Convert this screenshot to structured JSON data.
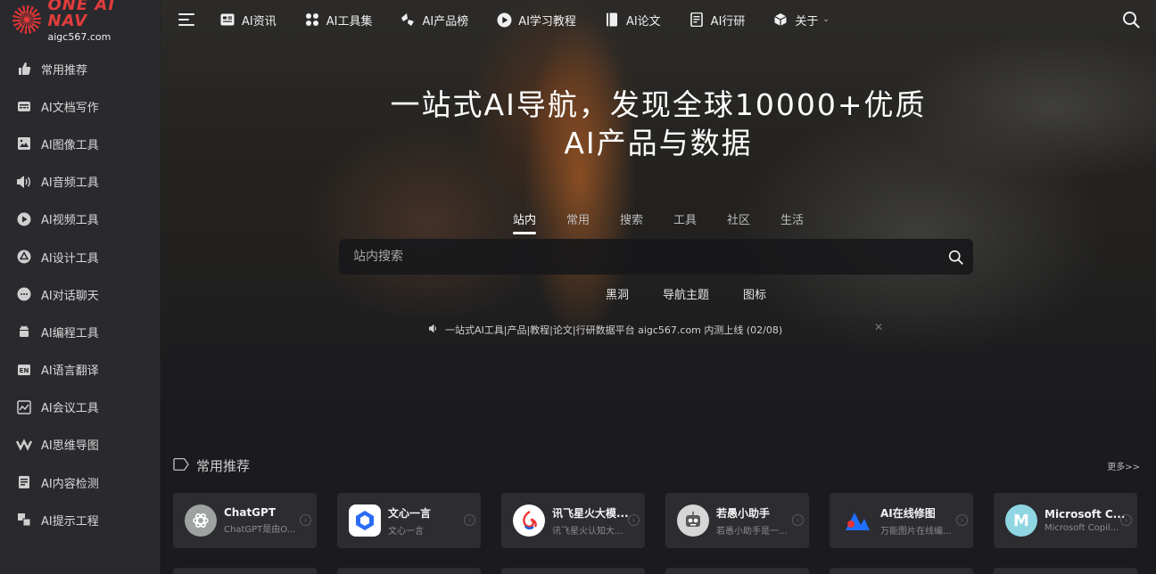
{
  "logo": {
    "title": "ONE AI NAV",
    "subtitle": "aigc567.com",
    "accent": "#e23c3c"
  },
  "sidebar": {
    "items": [
      {
        "label": "常用推荐",
        "icon": "thumb-up-icon"
      },
      {
        "label": "AI文档写作",
        "icon": "document-icon"
      },
      {
        "label": "AI图像工具",
        "icon": "image-icon"
      },
      {
        "label": "AI音频工具",
        "icon": "speaker-icon"
      },
      {
        "label": "AI视频工具",
        "icon": "play-icon"
      },
      {
        "label": "AI设计工具",
        "icon": "design-icon"
      },
      {
        "label": "AI对话聊天",
        "icon": "chat-icon"
      },
      {
        "label": "AI编程工具",
        "icon": "android-icon"
      },
      {
        "label": "AI语言翻译",
        "icon": "translate-icon"
      },
      {
        "label": "AI会议工具",
        "icon": "chart-icon"
      },
      {
        "label": "AI思维导图",
        "icon": "mindmap-icon"
      },
      {
        "label": "AI内容检测",
        "icon": "checklist-icon"
      },
      {
        "label": "AI提示工程",
        "icon": "blocks-icon"
      }
    ]
  },
  "topnav": {
    "items": [
      {
        "label": "AI资讯",
        "icon": "news-icon"
      },
      {
        "label": "AI工具集",
        "icon": "apps-icon"
      },
      {
        "label": "AI产品榜",
        "icon": "ranking-icon"
      },
      {
        "label": "AI学习教程",
        "icon": "play-circle-icon"
      },
      {
        "label": "AI论文",
        "icon": "book-icon"
      },
      {
        "label": "AI行研",
        "icon": "report-icon"
      },
      {
        "label": "关于",
        "icon": "cube-icon"
      }
    ]
  },
  "hero": {
    "title_line1": "一站式AI导航，发现全球10000+优质",
    "title_line2": "AI产品与数据",
    "tabs": [
      "站内",
      "常用",
      "搜索",
      "工具",
      "社区",
      "生活"
    ],
    "active_tab": "站内",
    "search_placeholder": "站内搜索",
    "links": [
      "黑洞",
      "导航主题",
      "图标"
    ],
    "notice": "一站式AI工具|产品|教程|论文|行研数据平台 aigc567.com 内测上线 (02/08)"
  },
  "section": {
    "title": "常用推荐",
    "more": "更多>>",
    "cards": [
      {
        "title": "ChatGPT",
        "desc": "ChatGPT是由O...",
        "logo": "chatgpt-logo",
        "color": "#a9a9a9"
      },
      {
        "title": "文心一言",
        "desc": "文心一言",
        "logo": "wenxin-logo",
        "color": "#ffffff"
      },
      {
        "title": "讯飞星火大模...",
        "desc": "讯飞星火认知大...",
        "logo": "xunfei-logo",
        "color": "#ffffff"
      },
      {
        "title": "若愚小助手",
        "desc": "若愚小助手是一...",
        "logo": "robot-logo",
        "color": "#d8d8d8"
      },
      {
        "title": "AI在线修图",
        "desc": "万能图片在线编...",
        "logo": "photo-edit-logo",
        "color": "#1f6fff"
      },
      {
        "title": "Microsoft C...",
        "desc": "Microsoft Copil...",
        "logo": "copilot-logo",
        "color": "#7fd3e0"
      }
    ]
  }
}
